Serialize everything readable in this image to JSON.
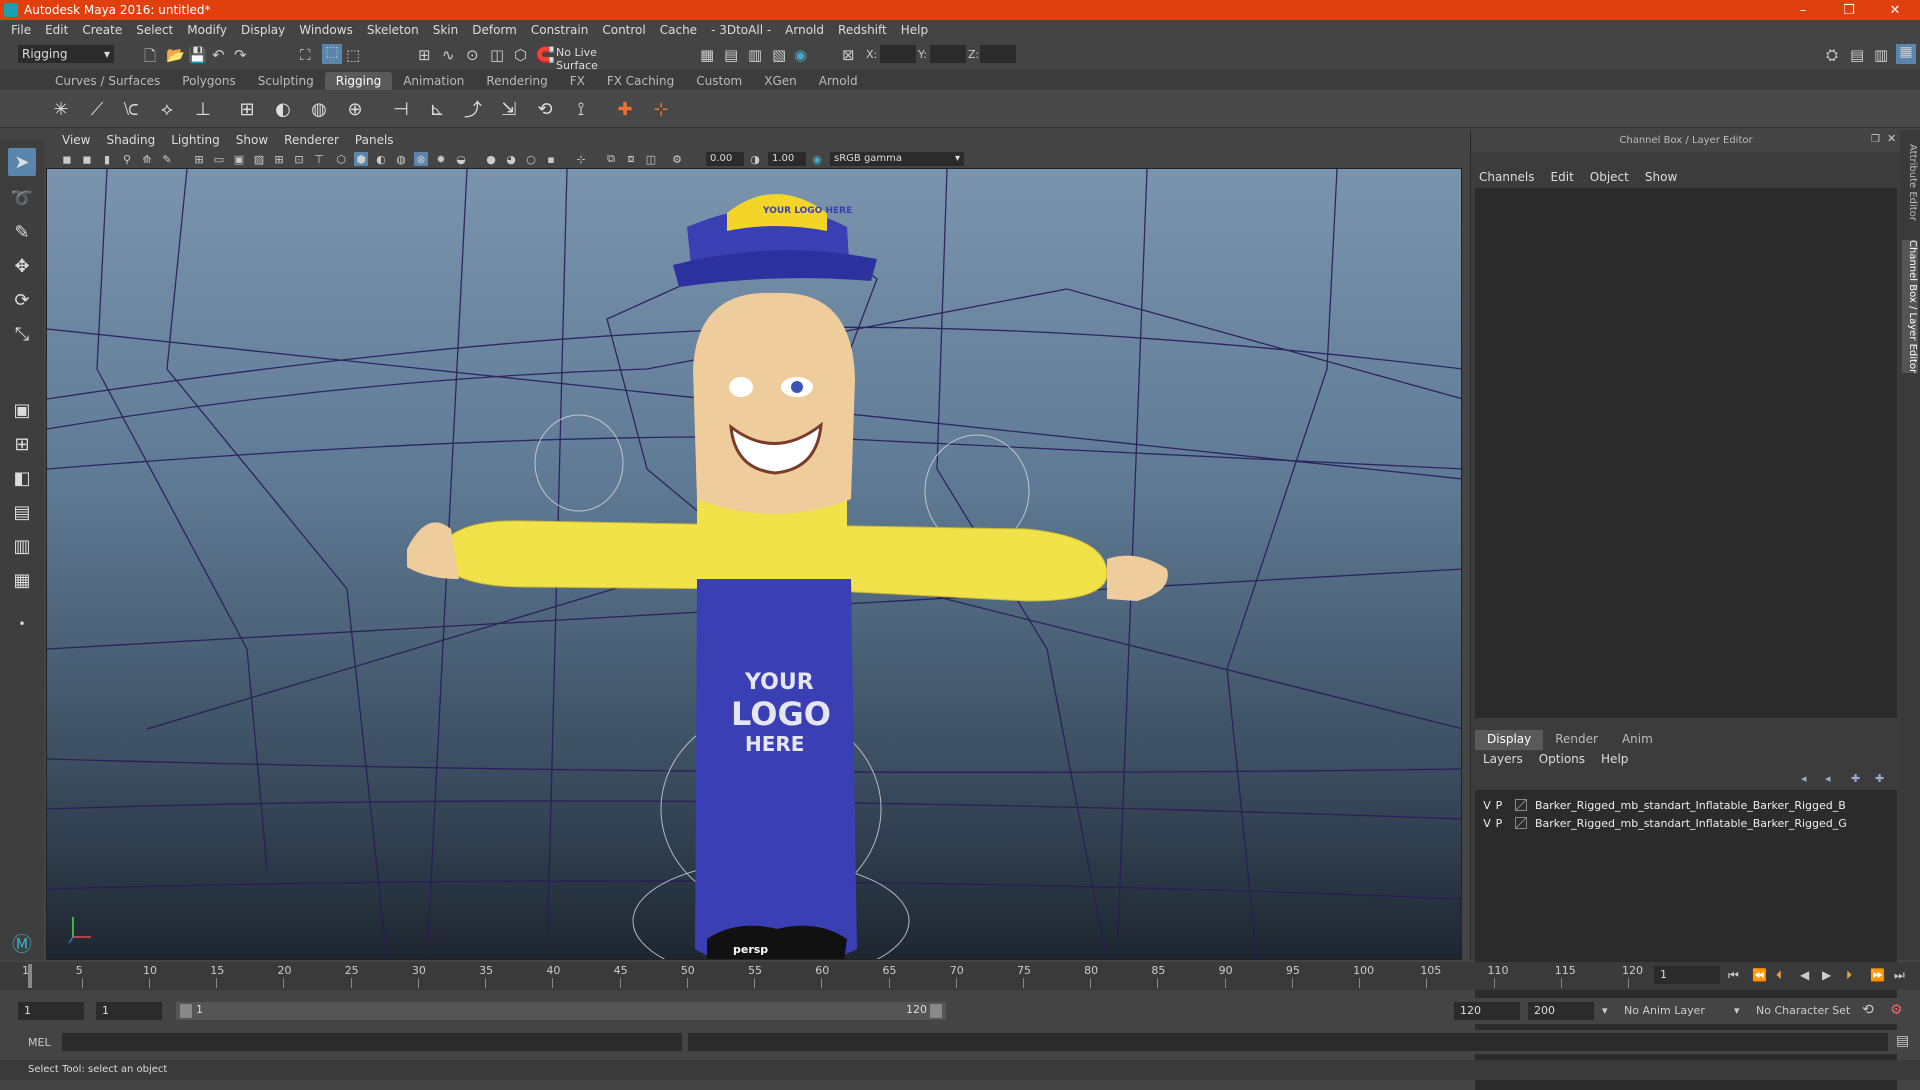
{
  "titlebar": {
    "title": "Autodesk Maya 2016: untitled*",
    "minimize": "–",
    "restore": "❒",
    "close": "✕"
  },
  "menubar": [
    "File",
    "Edit",
    "Create",
    "Select",
    "Modify",
    "Display",
    "Windows",
    "Skeleton",
    "Skin",
    "Deform",
    "Constrain",
    "Control",
    "Cache",
    "- 3DtoAll -",
    "Arnold",
    "Redshift",
    "Help"
  ],
  "statusline": {
    "menuset": "Rigging",
    "live_surface": "No Live Surface",
    "x_label": "X:",
    "y_label": "Y:",
    "z_label": "Z:"
  },
  "shelf_tabs": [
    {
      "label": "Curves / Surfaces",
      "active": false
    },
    {
      "label": "Polygons",
      "active": false
    },
    {
      "label": "Sculpting",
      "active": false
    },
    {
      "label": "Rigging",
      "active": true
    },
    {
      "label": "Animation",
      "active": false
    },
    {
      "label": "Rendering",
      "active": false
    },
    {
      "label": "FX",
      "active": false
    },
    {
      "label": "FX Caching",
      "active": false
    },
    {
      "label": "Custom",
      "active": false
    },
    {
      "label": "XGen",
      "active": false
    },
    {
      "label": "Arnold",
      "active": false
    }
  ],
  "viewport": {
    "menus": [
      "View",
      "Shading",
      "Lighting",
      "Show",
      "Renderer",
      "Panels"
    ],
    "exposure": "0.00",
    "gamma": "1.00",
    "color_space": "sRGB gamma",
    "camera": "persp",
    "logo_hat": "YOUR LOGO HERE",
    "logo_body_1": "YOUR",
    "logo_body_2": "LOGO",
    "logo_body_3": "HERE"
  },
  "right_panel": {
    "title": "Channel Box / Layer Editor",
    "channel_menus": [
      "Channels",
      "Edit",
      "Object",
      "Show"
    ],
    "layer_tabs": [
      {
        "label": "Display",
        "active": true
      },
      {
        "label": "Render",
        "active": false
      },
      {
        "label": "Anim",
        "active": false
      }
    ],
    "layer_menus": [
      "Layers",
      "Options",
      "Help"
    ],
    "layers": [
      {
        "v": "V",
        "p": "P",
        "name": "Barker_Rigged_mb_standart_Inflatable_Barker_Rigged_B"
      },
      {
        "v": "V",
        "p": "P",
        "name": "Barker_Rigged_mb_standart_Inflatable_Barker_Rigged_G"
      }
    ],
    "side_tabs": [
      "Attribute Editor",
      "Channel Box / Layer Editor"
    ]
  },
  "timeline": {
    "ticks": [
      "1",
      "5",
      "10",
      "15",
      "20",
      "25",
      "30",
      "35",
      "40",
      "45",
      "50",
      "55",
      "60",
      "65",
      "70",
      "75",
      "80",
      "85",
      "90",
      "95",
      "100",
      "105",
      "110",
      "115",
      "120"
    ],
    "current_frame": "1"
  },
  "range": {
    "start": "1",
    "playback_start": "1",
    "slider_start": "1",
    "slider_end": "120",
    "playback_end": "120",
    "end": "200",
    "anim_layer": "No Anim Layer",
    "char_set": "No Character Set"
  },
  "cmdline": {
    "lang": "MEL"
  },
  "status": {
    "help": "Select Tool: select an object"
  },
  "colors": {
    "title_bar": "#e0400e",
    "active_tool": "#5a86ae",
    "body_blue": "#3b3fb4",
    "shirt_yellow": "#f2e24a"
  }
}
